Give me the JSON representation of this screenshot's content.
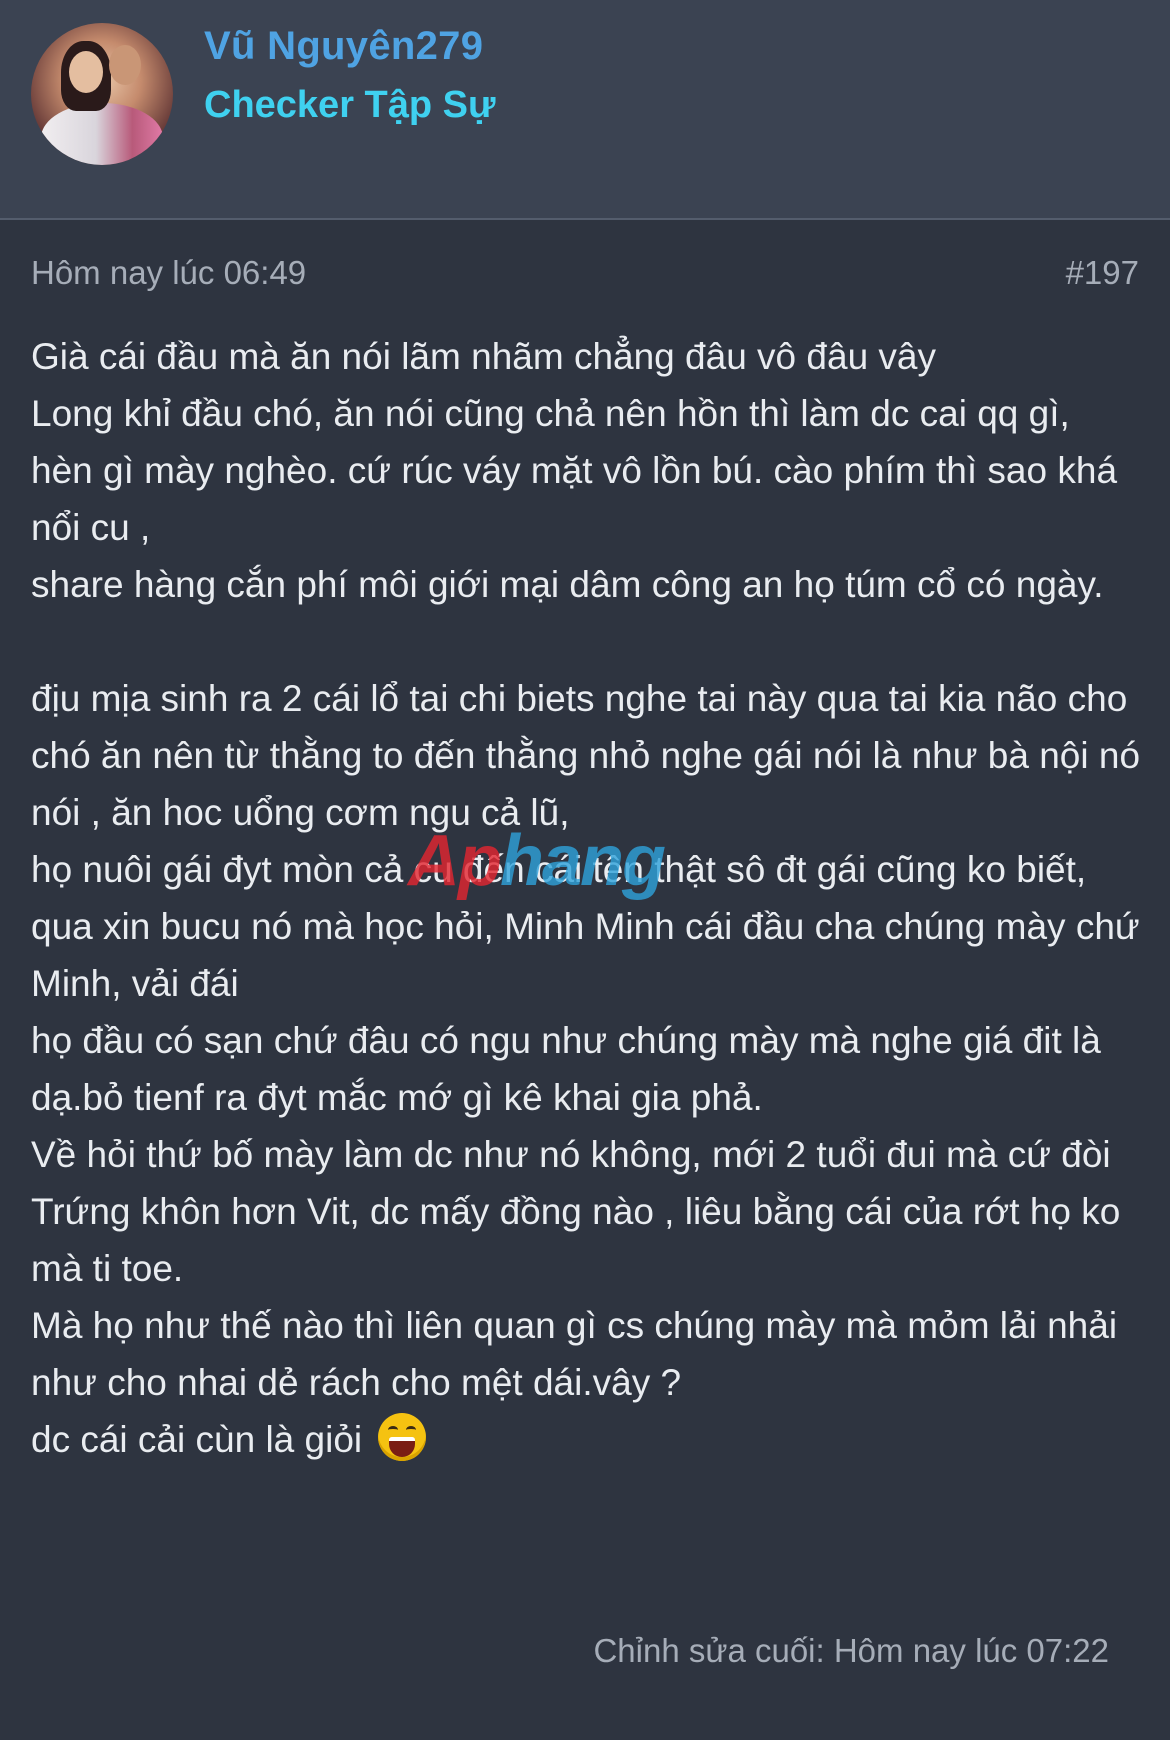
{
  "user": {
    "name": "Vũ Nguyên279",
    "title": "Checker Tập Sự"
  },
  "post": {
    "time": "Hôm nay lúc 06:49",
    "number": "#197",
    "paragraph1": [
      "Già cái đầu mà ăn nói lãm nhãm chẳng đâu vô đâu vây",
      "Long khỉ đầu chó, ăn nói cũng chả nên hồn thì làm dc cai qq gì,",
      "hèn gì mày nghèo. cứ rúc váy mặt vô lồn bú. cào phím thì sao khá nổi cu ,",
      "share hàng cắn phí môi giới mại dâm công an họ túm cổ có ngày."
    ],
    "paragraph2": [
      "địu mịa sinh ra 2 cái lổ tai chi biets nghe tai này qua tai kia não cho chó ăn nên từ thằng to đến thằng nhỏ nghe gái nói là như bà nội nó nói , ăn hoc uổng cơm ngu cả lũ,",
      "họ nuôi gái đyt mòn cả cu đến cái tên thật sô đt gái cũng ko biết, qua xin bucu nó mà học hỏi, Minh Minh cái đầu cha chúng mày chứ Minh, vải đái",
      "họ đầu có sạn chứ đâu có ngu như chúng mày mà nghe giá đit là dạ.bỏ tienf ra đyt mắc mớ gì kê khai gia phả.",
      "Về hỏi thứ bố mày làm dc như nó không, mới 2 tuổi đui mà cứ đòi Trứng khôn hơn Vit, dc mấy đồng nào , liêu bằng cái của rớt họ ko mà ti toe.",
      "Mà họ như thế nào thì liên quan gì cs chúng mày mà mỏm lải nhải như cho nhai dẻ rách cho mệt dái.vây ?",
      "dc cái cải cùn là giỏi"
    ],
    "emoji": "laughing-face-emoji",
    "edited": "Chỉnh sửa cuối: Hôm nay lúc 07:22"
  },
  "watermark": {
    "part1": "Ap",
    "part2": "hang",
    "color1": "#e52630",
    "color2": "#2fa3dc"
  },
  "colors": {
    "background": "#2e3440",
    "header": "#3b4352",
    "username": "#4fa3e3",
    "usertitle": "#3fd1f0",
    "meta": "#a6adb8",
    "text": "#e9ecf0"
  }
}
